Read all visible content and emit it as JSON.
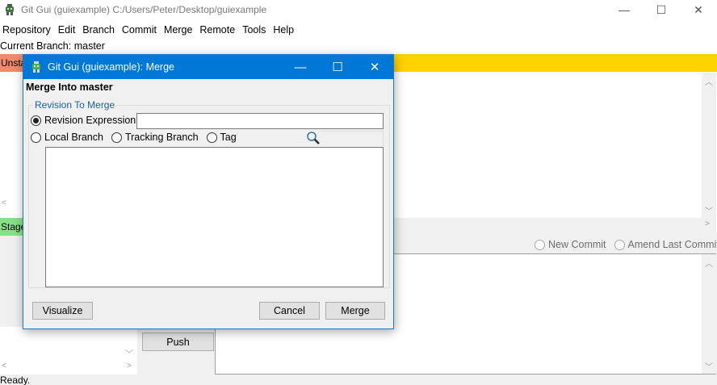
{
  "main_window": {
    "title": "Git Gui (guiexample) C:/Users/Peter/Desktop/guiexample",
    "minimize_glyph": "—",
    "maximize_glyph": "☐",
    "close_glyph": "✕"
  },
  "menubar": {
    "items": [
      "Repository",
      "Edit",
      "Branch",
      "Commit",
      "Merge",
      "Remote",
      "Tools",
      "Help"
    ]
  },
  "current_branch": "Current Branch: master",
  "unstaged_label": "Unstaged Changes",
  "staged_label": "Staged Changes",
  "commit_options": {
    "new_commit": "New Commit",
    "amend_last_commit": "Amend Last Commit"
  },
  "push_label": "Push",
  "status_text": "Ready.",
  "dialog": {
    "title": "Git Gui (guiexample): Merge",
    "heading": "Merge Into master",
    "group_legend": "Revision To Merge",
    "revision_expression_label": "Revision Expression:",
    "revision_expression_value": "",
    "local_branch_label": "Local Branch",
    "tracking_branch_label": "Tracking Branch",
    "tag_label": "Tag",
    "selected_source": "Revision Expression",
    "buttons": {
      "visualize": "Visualize",
      "cancel": "Cancel",
      "merge": "Merge"
    }
  },
  "colors": {
    "unstaged_bar": "#ffd200",
    "unstaged_tab": "#f08a6b",
    "staged_tab": "#86e086",
    "dialog_titlebar": "#0078d7",
    "legend_text": "#1a5fb4"
  },
  "icons": {
    "app_icon": "git-gui-icon",
    "search": "magnifier-icon"
  }
}
